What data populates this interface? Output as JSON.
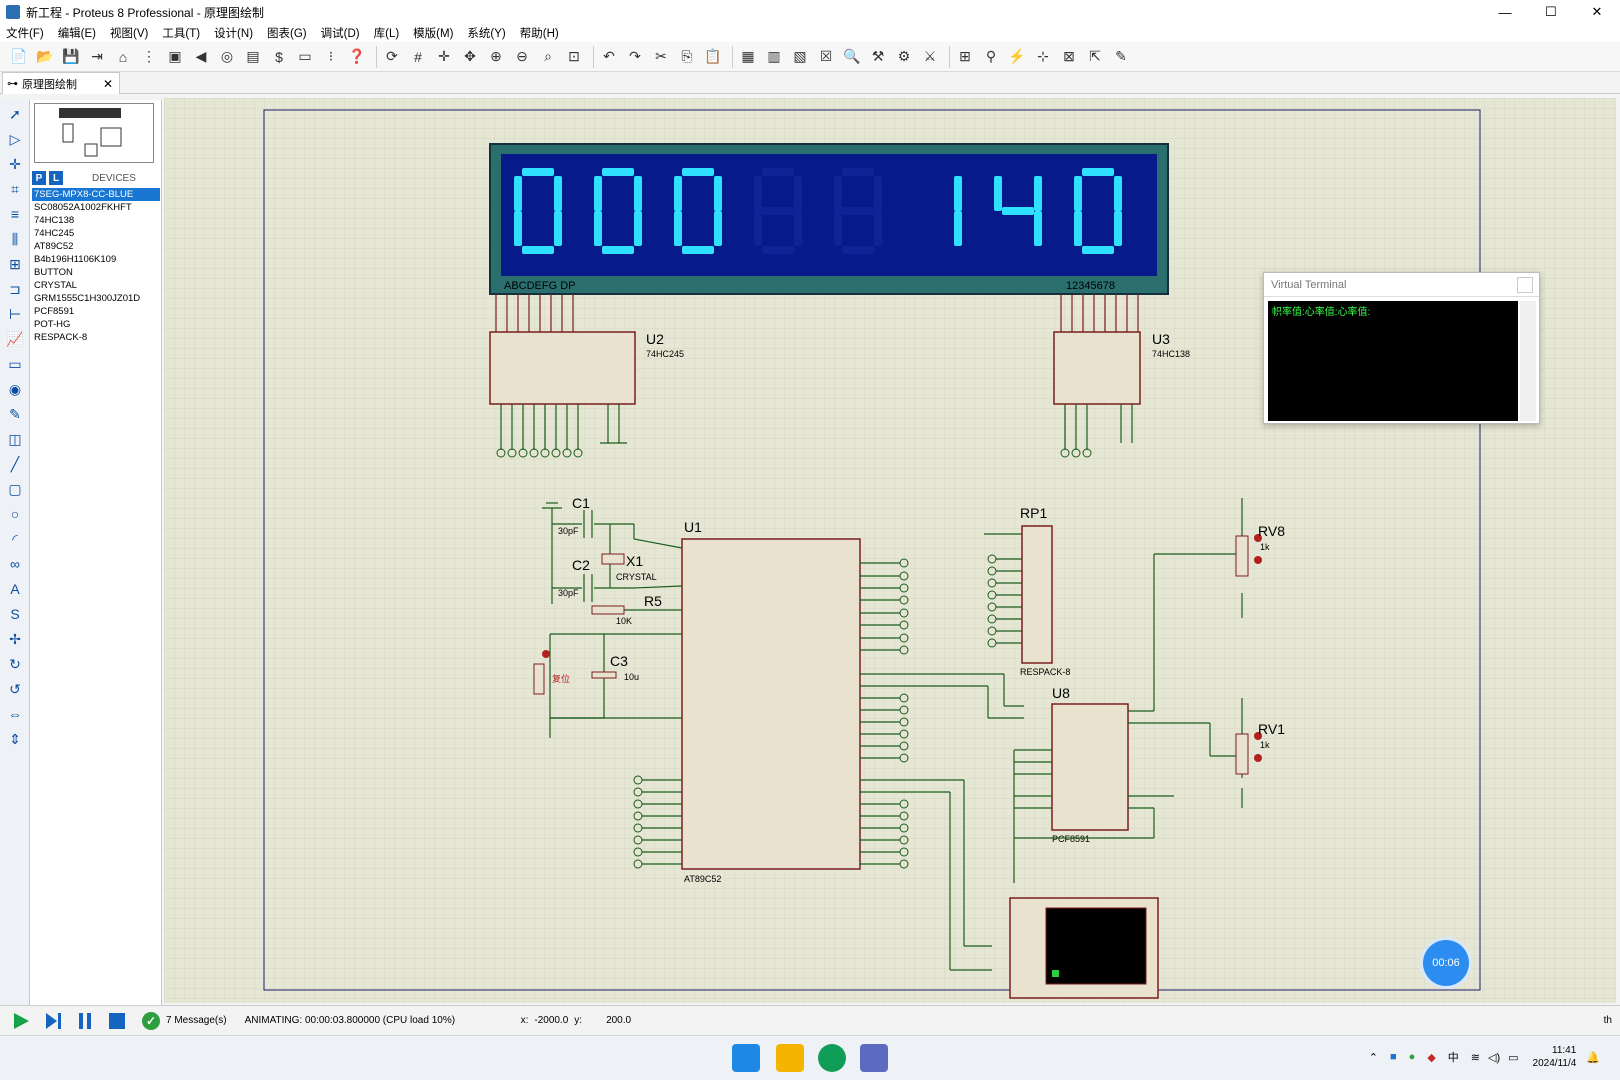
{
  "window": {
    "title": "新工程 - Proteus 8 Professional - 原理图绘制",
    "controls": [
      "—",
      "☐",
      "✕"
    ]
  },
  "menu": [
    "文件(F)",
    "编辑(E)",
    "视图(V)",
    "工具(T)",
    "设计(N)",
    "图表(G)",
    "调试(D)",
    "库(L)",
    "模版(M)",
    "系统(Y)",
    "帮助(H)"
  ],
  "tab": {
    "label": "原理图绘制",
    "close": "✕"
  },
  "devices": {
    "header": "DEVICES",
    "p_btn": "P",
    "l_btn": "L",
    "items": [
      "7SEG-MPX8-CC-BLUE",
      "SC08052A1002FKHFT",
      "74HC138",
      "74HC245",
      "AT89C52",
      "B4b196H1106K109",
      "BUTTON",
      "CRYSTAL",
      "GRM1555C1H300JZ01D",
      "PCF8591",
      "POT-HG",
      "RESPACK-8"
    ],
    "selected": "7SEG-MPX8-CC-BLUE"
  },
  "display": {
    "digits": [
      "0",
      "0",
      "0",
      "8",
      "8",
      "1",
      "4",
      "0"
    ],
    "lit": [
      true,
      true,
      true,
      false,
      false,
      true,
      true,
      true
    ],
    "seg_label": "ABCDEFG DP",
    "dig_label": "12345678"
  },
  "components": {
    "u1": {
      "ref": "U1",
      "type": "AT89C52"
    },
    "u2": {
      "ref": "U2",
      "type": "74HC245"
    },
    "u3": {
      "ref": "U3",
      "type": "74HC138"
    },
    "u8": {
      "ref": "U8",
      "type": "PCF8591"
    },
    "rp1": {
      "ref": "RP1",
      "type": "RESPACK-8"
    },
    "c1": {
      "ref": "C1",
      "val": "30pF"
    },
    "c2": {
      "ref": "C2",
      "val": "30pF"
    },
    "c3": {
      "ref": "C3",
      "val": "10u"
    },
    "x1": {
      "ref": "X1",
      "val": "CRYSTAL"
    },
    "r5": {
      "ref": "R5",
      "val": "10K"
    },
    "rv8": {
      "ref": "RV8",
      "val": "1k"
    },
    "rv1": {
      "ref": "RV1",
      "val": "1k"
    },
    "reset": "复位"
  },
  "virtual_terminal": {
    "title": "Virtual Terminal",
    "content": "帜率值:心率值:心率值:"
  },
  "status": {
    "messages": "7 Message(s)",
    "animating": "ANIMATING: 00:00:03.800000 (CPU load 10%)",
    "x_label": "x:",
    "x_val": "-2000.0",
    "y_label": "y:",
    "y_val": "200.0",
    "unit": "th"
  },
  "timer": "00:06",
  "clock": {
    "time": "11:41",
    "date": "2024/11/4"
  },
  "tray": {
    "ime": "中"
  },
  "colors": {
    "canvas": "#e6e6d5",
    "component": "#e8e2cf",
    "wire": "#1a5c1a",
    "outline": "#7a1e1e",
    "display_bg": "#071a8a",
    "display_border": "#2b6e6e",
    "segment_on": "#30e0ff",
    "segment_off": "#0e2396"
  }
}
